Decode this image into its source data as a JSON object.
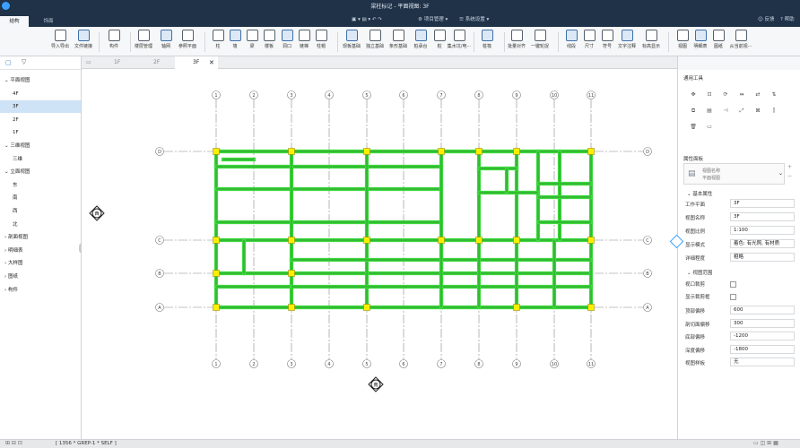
{
  "app": {
    "title": "梁柱标记 - 平面视图: 3F",
    "tabs": [
      "结构",
      "饰面"
    ],
    "quick_access": [
      "项目管理",
      "系统设置"
    ],
    "right_actions": [
      "反馈",
      "帮助"
    ]
  },
  "ribbon": {
    "buttons": [
      "导入导出",
      "文件链接",
      "构件",
      "楼层管理",
      "轴网",
      "参照平面",
      "柱",
      "墙",
      "梁",
      "楼板",
      "洞口",
      "链梯",
      "柱帽",
      "现板基础",
      "独立基础",
      "条形基础",
      "桩承台",
      "桩",
      "集水坑/电···",
      "桩筏",
      "批量对齐",
      "一键轮捉",
      "线段",
      "尺寸",
      "符号",
      "文字注释",
      "标高显示",
      "视图",
      "明细表",
      "图纸",
      "从当前视···"
    ]
  },
  "left_panel": {
    "tree": [
      {
        "label": "平面视图",
        "level": 0,
        "expanded": true
      },
      {
        "label": "4F",
        "level": 1
      },
      {
        "label": "3F",
        "level": 1,
        "selected": true
      },
      {
        "label": "2F",
        "level": 1
      },
      {
        "label": "1F",
        "level": 1
      },
      {
        "label": "三维视图",
        "level": 0,
        "expanded": true
      },
      {
        "label": "三维",
        "level": 1
      },
      {
        "label": "立面视图",
        "level": 0,
        "expanded": true
      },
      {
        "label": "东",
        "level": 1
      },
      {
        "label": "南",
        "level": 1
      },
      {
        "label": "西",
        "level": 1
      },
      {
        "label": "北",
        "level": 1
      },
      {
        "label": "剖面视图",
        "level": 0
      },
      {
        "label": "明细表",
        "level": 0
      },
      {
        "label": "大样图",
        "level": 0
      },
      {
        "label": "图纸",
        "level": 0
      },
      {
        "label": "构件",
        "level": 0
      }
    ]
  },
  "doc_tabs": [
    {
      "label": "1F"
    },
    {
      "label": "2F"
    },
    {
      "label": "3F",
      "active": true
    }
  ],
  "plan": {
    "columns": [
      "1",
      "2",
      "3",
      "4",
      "5",
      "6",
      "7",
      "8",
      "9",
      "10",
      "11"
    ],
    "rows": [
      "D",
      "C",
      "B",
      "A"
    ],
    "markers": [
      "西",
      "南",
      "东"
    ]
  },
  "right_panel": {
    "tools_title": "通用工具",
    "props_title": "属性面板",
    "view_name": "视图名称",
    "view_type": "平面视图",
    "basic_section": "基本属性",
    "basic": [
      {
        "label": "工作平面",
        "value": "3F"
      },
      {
        "label": "视图名称",
        "value": "3F"
      },
      {
        "label": "视图比例",
        "value": "1:100"
      },
      {
        "label": "显示模式",
        "value": "着色: 有光照, 有材质"
      },
      {
        "label": "详细程度",
        "value": "粗略"
      }
    ],
    "range_section": "视图范围",
    "checks": [
      {
        "label": "视口裁剪"
      },
      {
        "label": "显示裁剪框"
      }
    ],
    "range": [
      {
        "label": "顶部偏移",
        "value": "600"
      },
      {
        "label": "剖切面偏移",
        "value": "300"
      },
      {
        "label": "底部偏移",
        "value": "-1200"
      },
      {
        "label": "深度偏移",
        "value": "-1800"
      },
      {
        "label": "视图样板",
        "value": "无"
      }
    ]
  },
  "status": {
    "text": "[ 1356 * GREP-1 * SELF ]"
  },
  "colors": {
    "beam": "#3cd93c",
    "column": "#ffee00",
    "header": "#1f3248",
    "accent": "#3aa0ff"
  }
}
